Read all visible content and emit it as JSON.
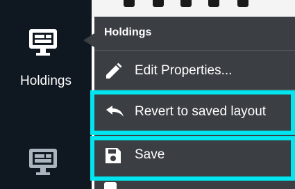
{
  "sidebar": {
    "items": [
      {
        "label": "Holdings",
        "icon": "desktop-dashboard-icon"
      },
      {
        "label": "",
        "icon": "desktop-dashboard-icon"
      }
    ]
  },
  "menu": {
    "title": "Holdings",
    "items": [
      {
        "label": "Edit Properties...",
        "icon": "pencil-icon"
      },
      {
        "label": "Revert to saved layout",
        "icon": "undo-icon"
      },
      {
        "label": "Save",
        "icon": "floppy-disk-icon"
      }
    ]
  },
  "colors": {
    "sidebar_bg": "#0f1720",
    "menu_bg": "#3b3f44",
    "highlight": "#00e5ee"
  }
}
